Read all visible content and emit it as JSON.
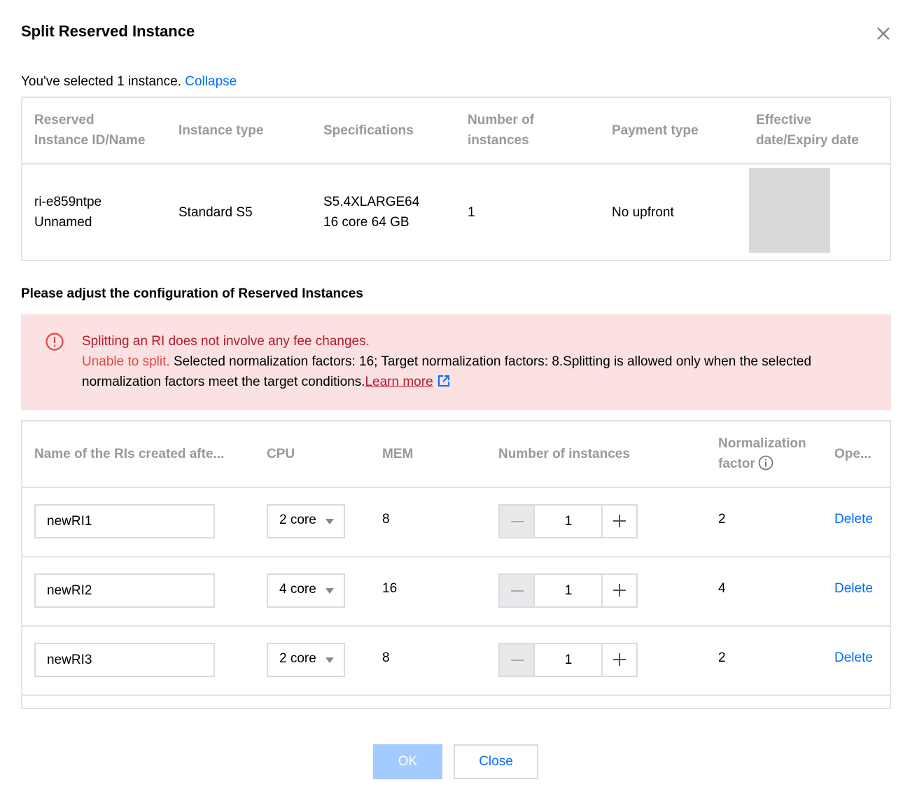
{
  "dialog": {
    "title": "Split Reserved Instance",
    "close_icon": "close-icon"
  },
  "selection": {
    "text": "You've selected 1 instance.",
    "collapse_label": "Collapse"
  },
  "instance_table": {
    "headers": {
      "id_line1": "Reserved",
      "id_line2": "Instance ID/Name",
      "type": "Instance type",
      "spec": "Specifications",
      "count_line1": "Number of",
      "count_line2": "instances",
      "payment": "Payment type",
      "date_line1": "Effective",
      "date_line2": "date/Expiry date"
    },
    "row": {
      "id": "ri-e859ntpe",
      "name": "Unnamed",
      "type": "Standard S5",
      "spec_line1": "S5.4XLARGE64",
      "spec_line2": "16 core 64 GB",
      "count": "1",
      "payment": "No upfront"
    }
  },
  "config": {
    "title": "Please adjust the configuration of Reserved Instances"
  },
  "alert": {
    "icon": "error-circle-icon",
    "line1": "Splitting an RI does not involve any fee changes.",
    "unable": "Unable to split.",
    "line2": " Selected normalization factors: 16; Target normalization factors: 8.Splitting is allowed only when the selected normalization factors meet the target conditions.",
    "learn_more": "Learn more",
    "link_icon": "external-link-icon",
    "colors": {
      "background": "#fbe1e1",
      "accent": "#e54545",
      "text_red": "#b5192d"
    }
  },
  "split_table": {
    "headers": {
      "name": "Name of the RIs created afte...",
      "cpu": "CPU",
      "mem": "MEM",
      "count": "Number of instances",
      "norm_line1": "Normalization",
      "norm_line2": "factor",
      "op": "Ope..."
    },
    "rows": [
      {
        "name": "newRI1",
        "cpu": "2 core",
        "mem": "8",
        "count": "1",
        "norm": "2",
        "action": "Delete"
      },
      {
        "name": "newRI2",
        "cpu": "4 core",
        "mem": "16",
        "count": "1",
        "norm": "4",
        "action": "Delete"
      },
      {
        "name": "newRI3",
        "cpu": "2 core",
        "mem": "8",
        "count": "1",
        "norm": "2",
        "action": "Delete"
      }
    ]
  },
  "footer": {
    "ok_label": "OK",
    "close_label": "Close"
  },
  "colors": {
    "link": "#006eff",
    "primary_disabled": "#a3cbff",
    "border": "#e2e3e6"
  }
}
